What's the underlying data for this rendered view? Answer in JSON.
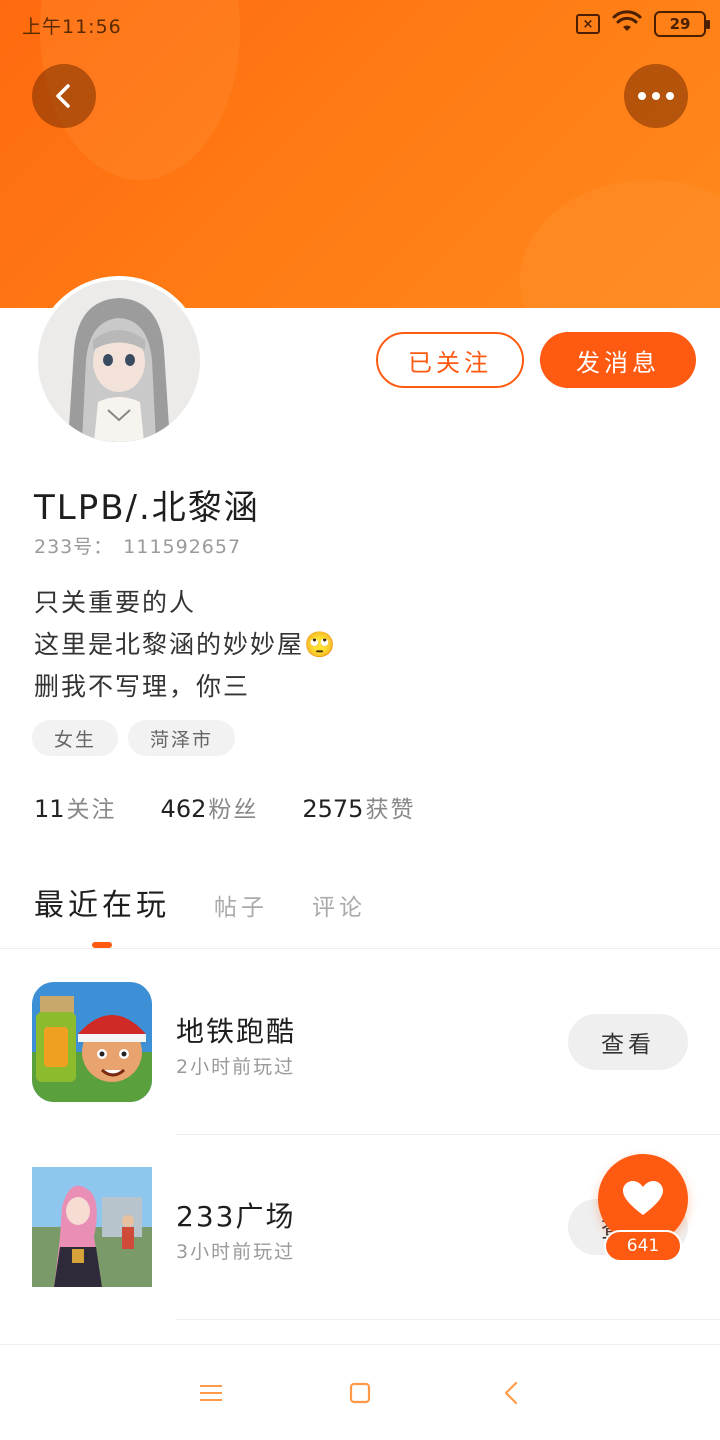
{
  "status_bar": {
    "time": "上午11:56",
    "battery": "29",
    "sim_icon": "sim-error-icon",
    "wifi_icon": "wifi-icon"
  },
  "header": {
    "back_icon": "chevron-left-icon",
    "more_icon": "more-dots-icon",
    "banner_color": "#ff7514"
  },
  "profile": {
    "username": "TLPB/.北黎涵",
    "id_label": "233号：",
    "id_value": "111592657",
    "follow_button": "已关注",
    "message_button": "发消息",
    "bio_lines": [
      "只关重要的人",
      "这里是北黎涵的妙妙屋🙄",
      "删我不写理，你三"
    ],
    "tags": [
      "女生",
      "菏泽市"
    ],
    "stats": [
      {
        "value": "11",
        "label": "关注"
      },
      {
        "value": "462",
        "label": "粉丝"
      },
      {
        "value": "2575",
        "label": "获赞"
      }
    ]
  },
  "tabs": [
    {
      "label": "最近在玩",
      "active": true
    },
    {
      "label": "帖子",
      "active": false
    },
    {
      "label": "评论",
      "active": false
    }
  ],
  "games": [
    {
      "name": "地铁跑酷",
      "time": "2小时前玩过",
      "button": "查看"
    },
    {
      "name": "233广场",
      "time": "3小时前玩过",
      "button": "查看"
    }
  ],
  "like_fab": {
    "icon": "heart-icon",
    "count": "641"
  },
  "nav_bar": {
    "menu_icon": "menu-icon",
    "home_icon": "home-square-icon",
    "back_icon": "back-triangle-icon"
  },
  "colors": {
    "accent": "#ff5a12",
    "text_primary": "#1e1e1e",
    "text_secondary": "#9a9a9a"
  }
}
